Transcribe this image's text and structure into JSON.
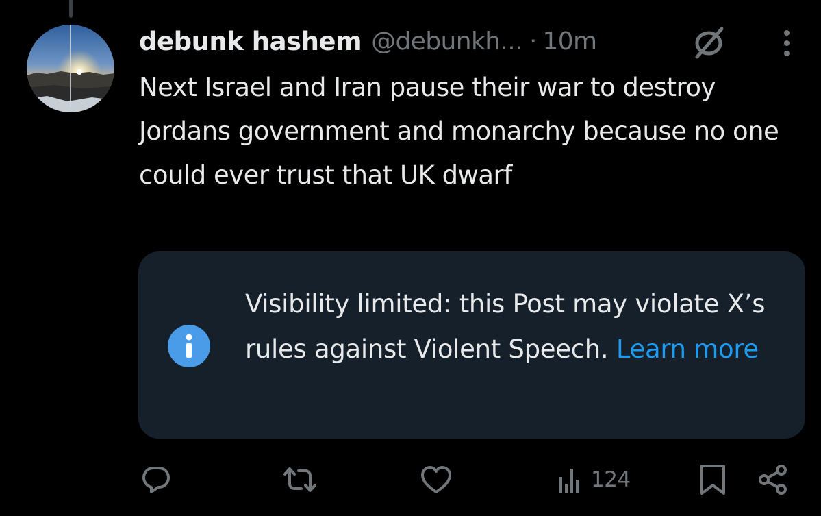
{
  "post": {
    "display_name": "debunk hashem",
    "handle": "@debunkh...",
    "separator": "·",
    "time": "10m",
    "text": "Next Israel and Iran pause their war to destroy Jordans government and monarchy because no one could ever trust that UK dwarf"
  },
  "notice": {
    "message": "Visibility limited: this Post may violate X’s rules against Violent Speech.",
    "link_label": "Learn more",
    "icon": "info-icon"
  },
  "actions": {
    "reply_icon": "reply-icon",
    "repost_icon": "repost-icon",
    "like_icon": "like-icon",
    "views_icon": "views-icon",
    "views_count": "124",
    "bookmark_icon": "bookmark-icon",
    "share_icon": "share-icon"
  },
  "colors": {
    "background": "#000000",
    "primary_text": "#e7e9ea",
    "secondary_text": "#71767b",
    "notice_background": "#16202a",
    "link": "#1d9bf0",
    "info_icon": "#4a9be8"
  }
}
